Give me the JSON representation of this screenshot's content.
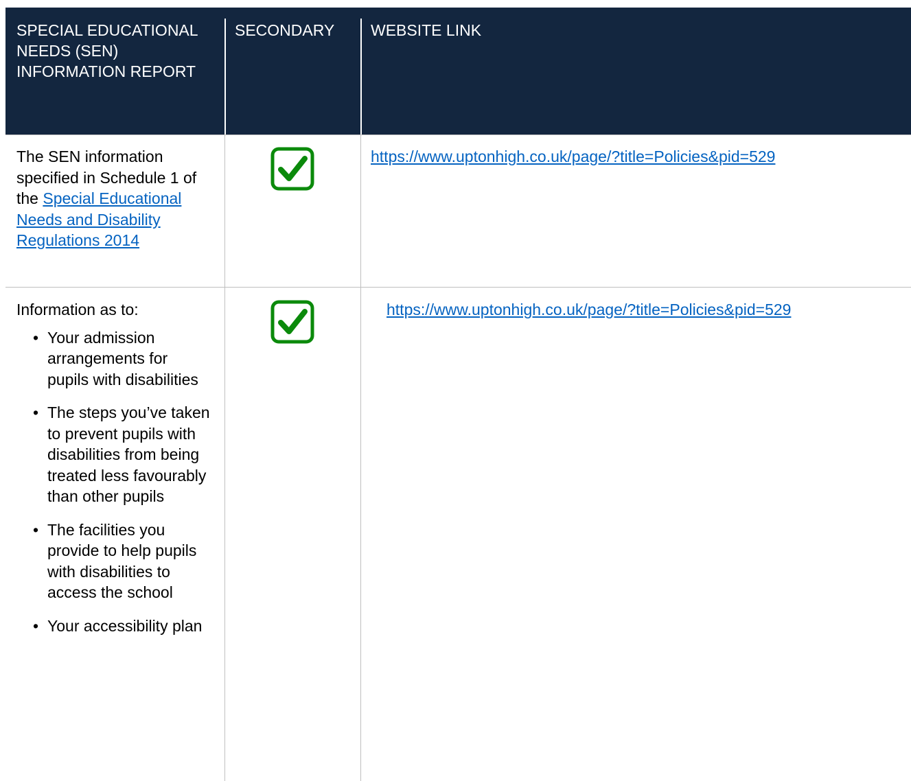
{
  "header": {
    "col1": "SPECIAL EDUCATIONAL NEEDS (SEN) INFORMATION REPORT",
    "col2": "SECONDARY",
    "col3": "WEBSITE LINK"
  },
  "rows": [
    {
      "text_before_link": "The SEN information specified in Schedule 1 of the ",
      "regulation_link": "Special Educational Needs and Disability Regulations 2014",
      "website_link": "https://www.uptonhigh.co.uk/page/?title=Policies&pid=529",
      "checked_icon": "checkbox-checked-icon"
    },
    {
      "intro": "Information as to:",
      "bullets": [
        "Your admission arrangements for pupils with disabilities",
        "The steps you’ve taken to prevent pupils with disabilities from being treated less favourably than other pupils",
        "The facilities you provide to help pupils with disabilities to access the school",
        "Your accessibility plan"
      ],
      "website_link": "https://www.uptonhigh.co.uk/page/?title=Policies&pid=529",
      "checked_icon": "checkbox-checked-icon"
    }
  ],
  "colors": {
    "header_bg": "#13263f",
    "link": "#0563c1",
    "check_green": "#0b8a0b"
  }
}
